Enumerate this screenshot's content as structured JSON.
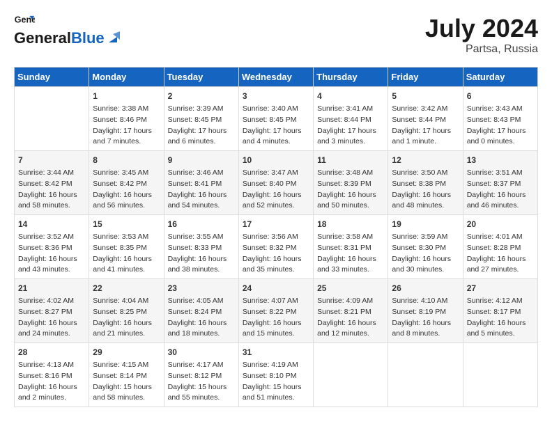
{
  "header": {
    "logo_general": "General",
    "logo_blue": "Blue",
    "title": "July 2024",
    "subtitle": "Partsa, Russia"
  },
  "days_of_week": [
    "Sunday",
    "Monday",
    "Tuesday",
    "Wednesday",
    "Thursday",
    "Friday",
    "Saturday"
  ],
  "weeks": [
    [
      {
        "day": "",
        "info": ""
      },
      {
        "day": "1",
        "info": "Sunrise: 3:38 AM\nSunset: 8:46 PM\nDaylight: 17 hours\nand 7 minutes."
      },
      {
        "day": "2",
        "info": "Sunrise: 3:39 AM\nSunset: 8:45 PM\nDaylight: 17 hours\nand 6 minutes."
      },
      {
        "day": "3",
        "info": "Sunrise: 3:40 AM\nSunset: 8:45 PM\nDaylight: 17 hours\nand 4 minutes."
      },
      {
        "day": "4",
        "info": "Sunrise: 3:41 AM\nSunset: 8:44 PM\nDaylight: 17 hours\nand 3 minutes."
      },
      {
        "day": "5",
        "info": "Sunrise: 3:42 AM\nSunset: 8:44 PM\nDaylight: 17 hours\nand 1 minute."
      },
      {
        "day": "6",
        "info": "Sunrise: 3:43 AM\nSunset: 8:43 PM\nDaylight: 17 hours\nand 0 minutes."
      }
    ],
    [
      {
        "day": "7",
        "info": "Sunrise: 3:44 AM\nSunset: 8:42 PM\nDaylight: 16 hours\nand 58 minutes."
      },
      {
        "day": "8",
        "info": "Sunrise: 3:45 AM\nSunset: 8:42 PM\nDaylight: 16 hours\nand 56 minutes."
      },
      {
        "day": "9",
        "info": "Sunrise: 3:46 AM\nSunset: 8:41 PM\nDaylight: 16 hours\nand 54 minutes."
      },
      {
        "day": "10",
        "info": "Sunrise: 3:47 AM\nSunset: 8:40 PM\nDaylight: 16 hours\nand 52 minutes."
      },
      {
        "day": "11",
        "info": "Sunrise: 3:48 AM\nSunset: 8:39 PM\nDaylight: 16 hours\nand 50 minutes."
      },
      {
        "day": "12",
        "info": "Sunrise: 3:50 AM\nSunset: 8:38 PM\nDaylight: 16 hours\nand 48 minutes."
      },
      {
        "day": "13",
        "info": "Sunrise: 3:51 AM\nSunset: 8:37 PM\nDaylight: 16 hours\nand 46 minutes."
      }
    ],
    [
      {
        "day": "14",
        "info": "Sunrise: 3:52 AM\nSunset: 8:36 PM\nDaylight: 16 hours\nand 43 minutes."
      },
      {
        "day": "15",
        "info": "Sunrise: 3:53 AM\nSunset: 8:35 PM\nDaylight: 16 hours\nand 41 minutes."
      },
      {
        "day": "16",
        "info": "Sunrise: 3:55 AM\nSunset: 8:33 PM\nDaylight: 16 hours\nand 38 minutes."
      },
      {
        "day": "17",
        "info": "Sunrise: 3:56 AM\nSunset: 8:32 PM\nDaylight: 16 hours\nand 35 minutes."
      },
      {
        "day": "18",
        "info": "Sunrise: 3:58 AM\nSunset: 8:31 PM\nDaylight: 16 hours\nand 33 minutes."
      },
      {
        "day": "19",
        "info": "Sunrise: 3:59 AM\nSunset: 8:30 PM\nDaylight: 16 hours\nand 30 minutes."
      },
      {
        "day": "20",
        "info": "Sunrise: 4:01 AM\nSunset: 8:28 PM\nDaylight: 16 hours\nand 27 minutes."
      }
    ],
    [
      {
        "day": "21",
        "info": "Sunrise: 4:02 AM\nSunset: 8:27 PM\nDaylight: 16 hours\nand 24 minutes."
      },
      {
        "day": "22",
        "info": "Sunrise: 4:04 AM\nSunset: 8:25 PM\nDaylight: 16 hours\nand 21 minutes."
      },
      {
        "day": "23",
        "info": "Sunrise: 4:05 AM\nSunset: 8:24 PM\nDaylight: 16 hours\nand 18 minutes."
      },
      {
        "day": "24",
        "info": "Sunrise: 4:07 AM\nSunset: 8:22 PM\nDaylight: 16 hours\nand 15 minutes."
      },
      {
        "day": "25",
        "info": "Sunrise: 4:09 AM\nSunset: 8:21 PM\nDaylight: 16 hours\nand 12 minutes."
      },
      {
        "day": "26",
        "info": "Sunrise: 4:10 AM\nSunset: 8:19 PM\nDaylight: 16 hours\nand 8 minutes."
      },
      {
        "day": "27",
        "info": "Sunrise: 4:12 AM\nSunset: 8:17 PM\nDaylight: 16 hours\nand 5 minutes."
      }
    ],
    [
      {
        "day": "28",
        "info": "Sunrise: 4:13 AM\nSunset: 8:16 PM\nDaylight: 16 hours\nand 2 minutes."
      },
      {
        "day": "29",
        "info": "Sunrise: 4:15 AM\nSunset: 8:14 PM\nDaylight: 15 hours\nand 58 minutes."
      },
      {
        "day": "30",
        "info": "Sunrise: 4:17 AM\nSunset: 8:12 PM\nDaylight: 15 hours\nand 55 minutes."
      },
      {
        "day": "31",
        "info": "Sunrise: 4:19 AM\nSunset: 8:10 PM\nDaylight: 15 hours\nand 51 minutes."
      },
      {
        "day": "",
        "info": ""
      },
      {
        "day": "",
        "info": ""
      },
      {
        "day": "",
        "info": ""
      }
    ]
  ]
}
